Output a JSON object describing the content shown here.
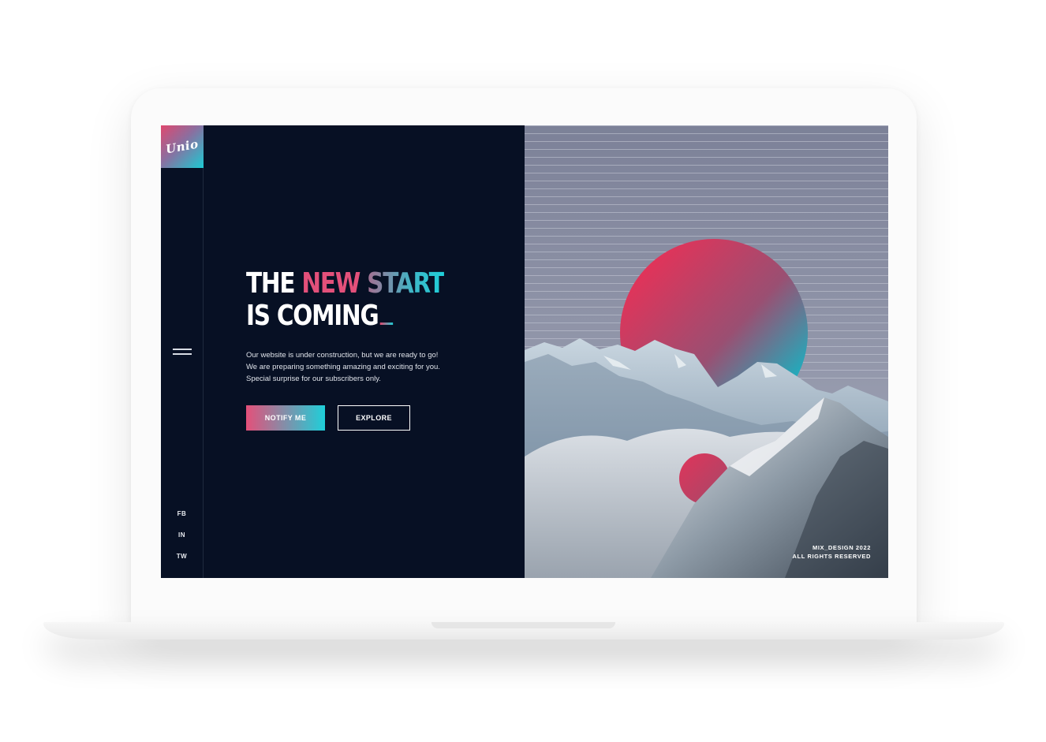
{
  "brand": {
    "logo_text": "Unio"
  },
  "hero": {
    "headline_part1": "THE",
    "headline_new": "NEW",
    "headline_start": "START",
    "headline_line2": "IS COMING",
    "description": [
      "Our website is under construction, but we are ready to go!",
      "We are preparing something amazing and exciting for you.",
      "Special surprise for our subscribers only."
    ],
    "notify_label": "NOTIFY ME",
    "explore_label": "EXPLORE"
  },
  "social": {
    "fb": "FB",
    "in": "IN",
    "tw": "TW"
  },
  "footer": {
    "line1": "MIX_DESIGN 2022",
    "line2": "ALL RIGHTS RESERVED"
  },
  "colors": {
    "background": "#071024",
    "accent_pink": "#e3507a",
    "accent_cyan": "#1ecfd9",
    "sky": "#8a90a5"
  },
  "icons": {
    "menu": "hamburger-menu-icon"
  }
}
